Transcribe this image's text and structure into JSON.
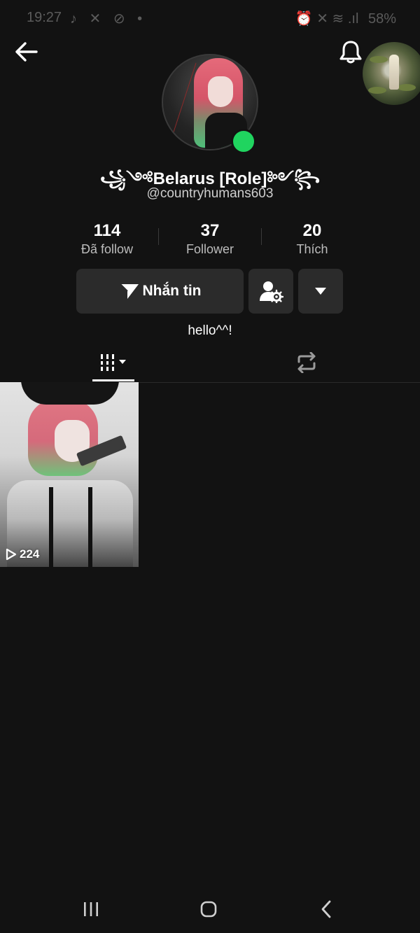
{
  "status_bar": {
    "time": "19:27",
    "left_icons": "♪ ✕ ⊘ •",
    "right_icons": "⏰ ✕ ≋ .ıl",
    "battery": "58%"
  },
  "profile": {
    "display_name": "꧁༺Belarus [Role]༻꧂",
    "username": "@countryhumans603",
    "bio": "hello^^!",
    "online_color": "#20d45f"
  },
  "stats": [
    {
      "value": "114",
      "label": "Đã follow"
    },
    {
      "value": "37",
      "label": "Follower"
    },
    {
      "value": "20",
      "label": "Thích"
    }
  ],
  "actions": {
    "message_label": "Nhắn tin"
  },
  "videos": [
    {
      "views": "224"
    }
  ],
  "icons": {
    "back": "arrow-left-icon",
    "bell": "bell-icon",
    "send": "send-icon",
    "person_settings": "person-gear-icon",
    "dropdown": "caret-down-icon",
    "videos_tab": "grid-icon",
    "repost_tab": "repost-icon",
    "play": "play-icon"
  }
}
